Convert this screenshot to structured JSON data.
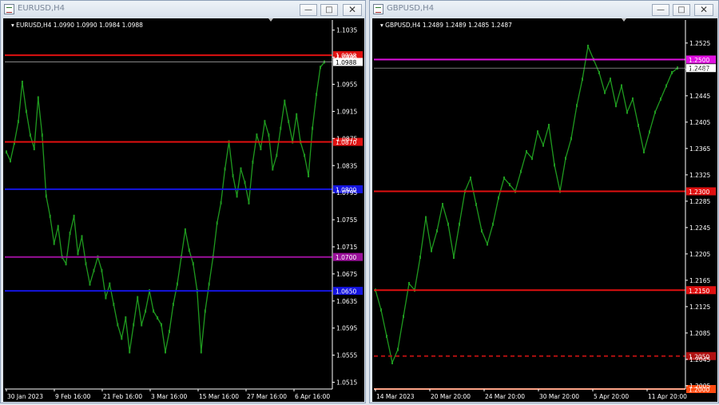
{
  "windows": [
    {
      "title": "EURUSD,H4",
      "controls": {
        "min": "—",
        "max": "□",
        "close": "✕"
      },
      "chart_data": {
        "type": "line",
        "title": "EURUSD,H4  1.0990 1.0990 1.0984 1.0988",
        "ylim": [
          1.0505,
          1.105
        ],
        "y_ticks": [
          "1.1035",
          "1.0995",
          "1.0955",
          "1.0915",
          "1.0875",
          "1.0835",
          "1.0795",
          "1.0755",
          "1.0715",
          "1.0675",
          "1.0635",
          "1.0595",
          "1.0555",
          "1.0515"
        ],
        "x_ticks": [
          "30 Jan 2023",
          "9 Feb 16:00",
          "21 Feb 16:00",
          "3 Mar 16:00",
          "15 Mar 16:00",
          "27 Mar 16:00",
          "6 Apr 16:00"
        ],
        "series": [
          {
            "color": "#1f9a1f",
            "values": [
              1.0855,
              1.0842,
              1.0868,
              1.09,
              1.0958,
              1.0915,
              1.088,
              1.086,
              1.0935,
              1.088,
              1.079,
              1.076,
              1.072,
              1.0745,
              1.07,
              1.069,
              1.0735,
              1.076,
              1.0705,
              1.073,
              1.069,
              1.066,
              1.068,
              1.07,
              1.068,
              1.064,
              1.066,
              1.063,
              1.06,
              1.058,
              1.061,
              1.056,
              1.06,
              1.064,
              1.06,
              1.062,
              1.065,
              1.062,
              1.061,
              1.06,
              1.056,
              1.059,
              1.063,
              1.066,
              1.07,
              1.074,
              1.071,
              1.069,
              1.065,
              1.056,
              1.062,
              1.066,
              1.07,
              1.075,
              1.078,
              1.083,
              1.087,
              1.082,
              1.079,
              1.083,
              1.081,
              1.078,
              1.084,
              1.088,
              1.086,
              1.09,
              1.088,
              1.083,
              1.085,
              1.089,
              1.093,
              1.09,
              1.087,
              1.091,
              1.087,
              1.085,
              1.082,
              1.089,
              1.094,
              1.098,
              1.0988
            ]
          }
        ],
        "hlines": [
          {
            "value": 1.0998,
            "color": "#e01010",
            "label": "1.0998"
          },
          {
            "value": 1.087,
            "color": "#e01010",
            "label": "1.0870"
          },
          {
            "value": 1.08,
            "color": "#1414e0",
            "label": "1.0800"
          },
          {
            "value": 1.07,
            "color": "#9a109a",
            "label": "1.0700"
          },
          {
            "value": 1.065,
            "color": "#1414e0",
            "label": "1.0650"
          },
          {
            "value": 1.0988,
            "color": "#9a9a9a",
            "label": "1.0988"
          }
        ]
      }
    },
    {
      "title": "GBPUSD,H4",
      "controls": {
        "min": "—",
        "max": "□",
        "close": "✕"
      },
      "chart_data": {
        "type": "line",
        "title": "GBPUSD,H4  1.2489 1.2489 1.2485 1.2487",
        "ylim": [
          1.2,
          1.256
        ],
        "y_ticks": [
          "1.2525",
          "1.2485",
          "1.2445",
          "1.2405",
          "1.2365",
          "1.2325",
          "1.2285",
          "1.2245",
          "1.2205",
          "1.2165",
          "1.2125",
          "1.2085",
          "1.2045",
          "1.2005"
        ],
        "x_ticks": [
          "14 Mar 2023",
          "20 Mar 20:00",
          "24 Mar 20:00",
          "30 Mar 20:00",
          "5 Apr 20:00",
          "11 Apr 20:00"
        ],
        "series": [
          {
            "color": "#1f9a1f",
            "values": [
              1.215,
              1.212,
              1.208,
              1.204,
              1.206,
              1.211,
              1.216,
              1.215,
              1.22,
              1.226,
              1.221,
              1.224,
              1.228,
              1.225,
              1.22,
              1.225,
              1.23,
              1.232,
              1.228,
              1.224,
              1.222,
              1.225,
              1.229,
              1.232,
              1.231,
              1.23,
              1.233,
              1.236,
              1.235,
              1.239,
              1.237,
              1.24,
              1.234,
              1.23,
              1.235,
              1.238,
              1.243,
              1.247,
              1.252,
              1.25,
              1.248,
              1.245,
              1.247,
              1.243,
              1.246,
              1.242,
              1.244,
              1.24,
              1.236,
              1.239,
              1.242,
              1.244,
              1.246,
              1.248,
              1.2487
            ]
          }
        ],
        "hlines": [
          {
            "value": 1.25,
            "color": "#e010e0",
            "label": "1.2500"
          },
          {
            "value": 1.2487,
            "color": "#9a9a9a",
            "label": "1.2487"
          },
          {
            "value": 1.23,
            "color": "#e01010",
            "label": "1.2300"
          },
          {
            "value": 1.215,
            "color": "#e01010",
            "label": "1.2150"
          },
          {
            "value": 1.205,
            "color": "#b01010",
            "label": "1.2050",
            "dashed": true
          },
          {
            "value": 1.2,
            "color": "#ff4a10",
            "label": "1.2000"
          }
        ]
      }
    }
  ]
}
